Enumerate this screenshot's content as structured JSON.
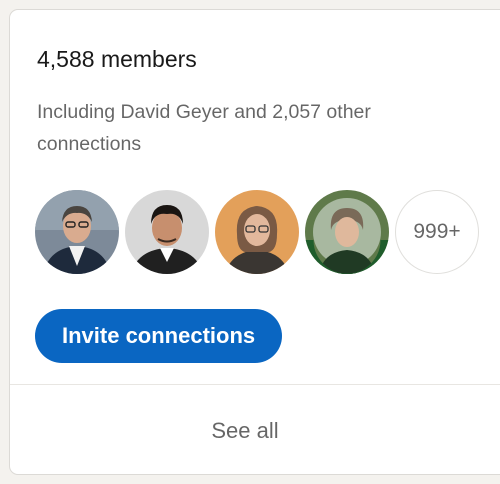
{
  "group_members": {
    "members_count": "4,588 members",
    "connections_summary": "Including David Geyer and 2,057 other connections",
    "more_count": "999+"
  },
  "actions": {
    "invite_label": "Invite connections",
    "see_all_label": "See all"
  },
  "colors": {
    "accent": "#0a66c2",
    "card_bg": "#ffffff",
    "page_bg": "#f4f2ee"
  }
}
